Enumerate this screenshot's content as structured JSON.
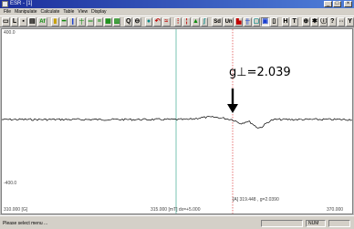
{
  "window": {
    "title": "ESR - [1]"
  },
  "menu": [
    "File",
    "Manipulate",
    "Calculate",
    "Table",
    "View",
    "Display"
  ],
  "toolbar": {
    "buttons": [
      {
        "label": "",
        "icon": "open-file-icon"
      },
      {
        "label": "L",
        "icon": "linear-icon"
      },
      {
        "label": "",
        "icon": "save-icon"
      },
      {
        "label": "",
        "icon": "print-icon"
      },
      {
        "label": "Af",
        "icon": "amplitude-icon"
      },
      {
        "label": "",
        "icon": "zoom-y-icon"
      },
      {
        "label": "",
        "icon": "baseline-icon"
      },
      {
        "label": "",
        "icon": "peak-pick-icon"
      },
      {
        "label": "",
        "icon": "peak-sum-icon"
      },
      {
        "label": "",
        "icon": "multi-trace-icon"
      },
      {
        "label": "",
        "icon": "stack-icon"
      },
      {
        "label": "",
        "icon": "overlay-icon"
      },
      {
        "label": "",
        "icon": "grid-icon"
      },
      {
        "label": "Q",
        "icon": "magnify-icon"
      },
      {
        "label": "",
        "icon": "zoom-out-icon"
      },
      {
        "label": "",
        "icon": "globe-icon"
      },
      {
        "label": "",
        "icon": "undo-icon"
      },
      {
        "label": "",
        "icon": "fit-icon"
      },
      {
        "label": "",
        "icon": "cursor-icon"
      },
      {
        "label": "",
        "icon": "mark-icon"
      },
      {
        "label": "",
        "icon": "peak-icon"
      },
      {
        "label": "",
        "icon": "integrate-icon"
      },
      {
        "label": "Sd",
        "icon": "std-icon"
      },
      {
        "label": "Un",
        "icon": "units-icon"
      },
      {
        "label": "",
        "icon": "chart-icon"
      },
      {
        "label": "",
        "icon": "split-icon"
      },
      {
        "label": "",
        "icon": "window-icon"
      },
      {
        "label": "",
        "icon": "panel-icon"
      },
      {
        "label": "",
        "icon": "border-icon"
      },
      {
        "label": "H",
        "icon": "help-icon"
      },
      {
        "label": "T",
        "icon": "text-icon"
      },
      {
        "label": "",
        "icon": "zoom-window-icon"
      },
      {
        "label": "",
        "icon": "settings-icon"
      },
      {
        "label": "",
        "icon": "info-icon"
      },
      {
        "label": "",
        "icon": "unknown-icon"
      },
      {
        "label": "",
        "icon": "expand-icon"
      },
      {
        "label": "Y",
        "icon": "y-axis-icon"
      }
    ]
  },
  "plot": {
    "corner_label": "400.0",
    "annotation": "g⊥=2.039",
    "cursor_readout": "[A]   319.448 , g=2.0390",
    "x_left": "310.000    [G]",
    "x_mid": "315.000  [mT]   dx=+5.000",
    "x_right": "370.000",
    "y_bottom": "-400.0",
    "colors": {
      "cyan_cursor": "#57b5a0",
      "red_cursor": "#e05050",
      "trace": "#000000"
    }
  },
  "status": {
    "message": "Please select menu ...",
    "panel2": "",
    "num": "NUM"
  }
}
